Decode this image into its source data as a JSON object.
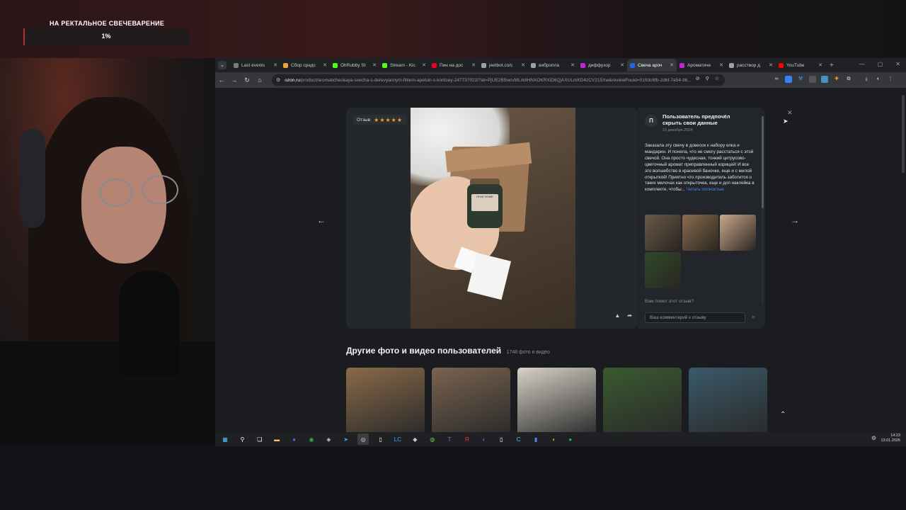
{
  "overlay": {
    "goal_title": "НА РЕКТАЛЬНОЕ СВЕЧЕВАРЕНИЕ",
    "goal_percent": "1%",
    "goal_fraction": 0.01,
    "goal_color": "#b33333"
  },
  "browser": {
    "tabs": [
      {
        "label": "Last events",
        "color": "#7a7a7a"
      },
      {
        "label": "Сбор средс",
        "color": "#e8a33a"
      },
      {
        "label": "OhRubby St",
        "color": "#53fc18"
      },
      {
        "label": "Stream - Kic",
        "color": "#53fc18"
      },
      {
        "label": "Пин на дос",
        "color": "#e60023"
      },
      {
        "label": "jeetbot.co/c",
        "color": "#9aa0a6"
      },
      {
        "label": "вибропла",
        "color": "#9aa0a6"
      },
      {
        "label": "диффузор",
        "color": "#c026d3"
      },
      {
        "label": "Свеча ароч",
        "color": "#2563eb",
        "active": true
      },
      {
        "label": "Ароматиче",
        "color": "#c026d3"
      },
      {
        "label": "расствор д",
        "color": "#9aa0a6"
      },
      {
        "label": "YouTube",
        "color": "#ff0000"
      }
    ],
    "url_host": "ozon.ru",
    "url_path": "/product/aromaticheskaya-svecha-s-derevyannym-fitilem-apelsin-s-koritsey-247737022/?at=PjUE2B5wcvMLrk8HNXOKRXiD6QjAXULmKD4zCV215Xw&reviewPuuid=0193c6fb-2d6f-7a54-96..."
  },
  "review": {
    "badge_label": "Отзыв",
    "rating": 5,
    "avatar_letter": "П",
    "author": "Пользователь предпочёл скрыть свои данные",
    "date": "15 декабря 2024",
    "text": "Заказала эту свечу в довесок к набору елка и мандарин. И поняла, что не смогу расстаться с этой свечой. Она просто чудесная, тонкий цитрусово-цветочный аромат приправленный корицей! И все это волшебство в красивой баночке, еще и с милой открыткой! Приятно что производитель заботится о таких мелочах как открыточка, еще и доп наклейка в комплекте, чтобы...",
    "more_label": "Читать полностью",
    "helpful_label": "Вам помог этот отзыв?",
    "comment_placeholder": "Ваш комментарий к отзыву",
    "jar_label": "HIVIE HOME",
    "thumbs": [
      "#6b5a48",
      "#8a6c50",
      "#c9a98a",
      "#2f4a2a"
    ]
  },
  "gallery": {
    "title": "Другие фото и видео пользователей",
    "count": "1748 фото и видео",
    "items": [
      "#8a6a48",
      "#7a6350",
      "#d8d2c8",
      "#3a5a30",
      "#3a5a6a"
    ]
  },
  "taskbar": {
    "time": "14:23",
    "date": "13.01.2026",
    "apps": [
      {
        "name": "windows-icon",
        "glyph": "▦",
        "color": "#4cc2ff"
      },
      {
        "name": "search-icon",
        "glyph": "⚲",
        "color": "#ffffff"
      },
      {
        "name": "task-view-icon",
        "glyph": "❏",
        "color": "#ffffff"
      },
      {
        "name": "explorer-icon",
        "glyph": "▬",
        "color": "#f2c94c"
      },
      {
        "name": "discord-icon",
        "glyph": "●",
        "color": "#5865f2"
      },
      {
        "name": "chrome-icon",
        "glyph": "◉",
        "color": "#34a853"
      },
      {
        "name": "steam-icon",
        "glyph": "◈",
        "color": "#c7d5e0"
      },
      {
        "name": "telegram-icon",
        "glyph": "➤",
        "color": "#2aabee"
      },
      {
        "name": "obs-icon",
        "glyph": "◎",
        "color": "#dddddd",
        "running": true
      },
      {
        "name": "notepad-icon",
        "glyph": "▯",
        "color": "#ffffff"
      },
      {
        "name": "lightshot-icon",
        "glyph": "LC",
        "color": "#4aa3ff"
      },
      {
        "name": "app-icon",
        "glyph": "◆",
        "color": "#cccccc"
      },
      {
        "name": "app-icon-2",
        "glyph": "◍",
        "color": "#7ac142"
      },
      {
        "name": "t-app-icon",
        "glyph": "T",
        "color": "#7b68ee"
      },
      {
        "name": "yandex-icon",
        "glyph": "Я",
        "color": "#ff3333"
      },
      {
        "name": "app-icon-3",
        "glyph": "◐",
        "color": "#6a5acd"
      },
      {
        "name": "file-icon",
        "glyph": "▯",
        "color": "#ffffff"
      },
      {
        "name": "cursor-app-icon",
        "glyph": "C",
        "color": "#4ec9f0"
      },
      {
        "name": "stats-icon",
        "glyph": "▮",
        "color": "#4a90e2"
      },
      {
        "name": "app-icon-4",
        "glyph": "◑",
        "color": "#e0a040"
      },
      {
        "name": "spotify-icon",
        "glyph": "●",
        "color": "#1db954"
      }
    ]
  }
}
